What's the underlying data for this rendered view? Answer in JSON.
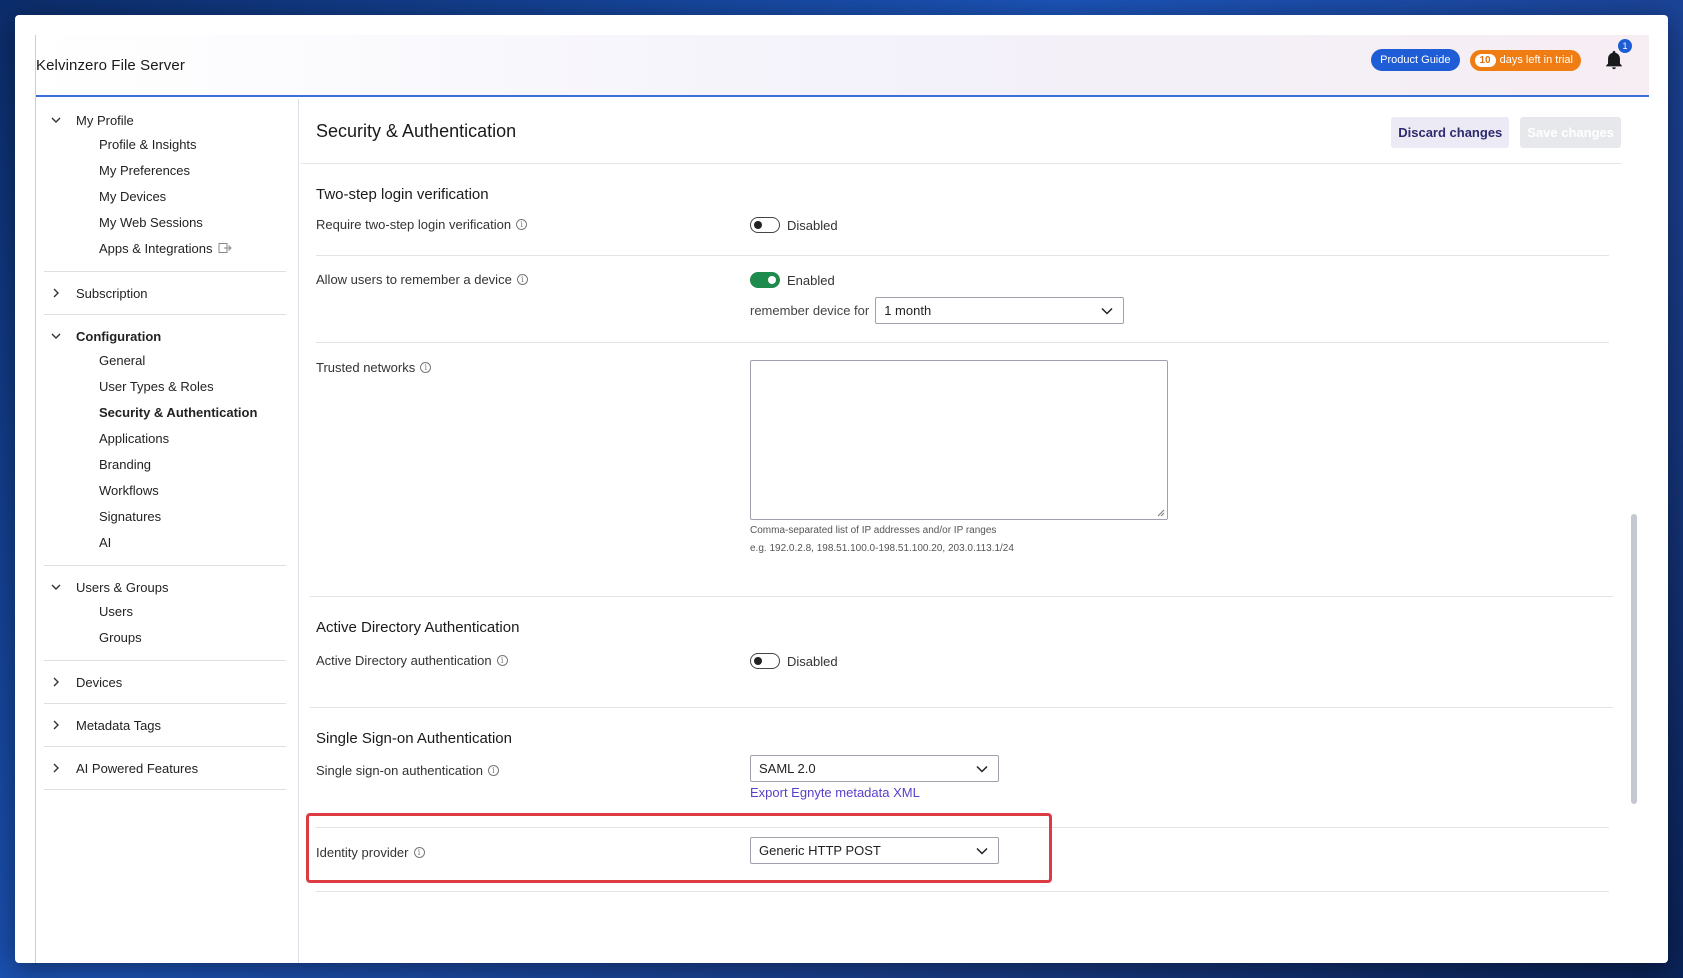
{
  "app": {
    "title": "Kelvinzero File Server",
    "product_guide": "Product Guide",
    "trial_days": "10",
    "trial_text": "days left in trial",
    "notification_count": "1"
  },
  "sidebar": {
    "groups": [
      {
        "label": "My Profile",
        "expanded": true,
        "items": [
          "Profile & Insights",
          "My Preferences",
          "My Devices",
          "My Web Sessions",
          "Apps & Integrations"
        ]
      },
      {
        "label": "Subscription",
        "expanded": false,
        "items": []
      },
      {
        "label": "Configuration",
        "expanded": true,
        "items": [
          "General",
          "User Types & Roles",
          "Security & Authentication",
          "Applications",
          "Branding",
          "Workflows",
          "Signatures",
          "AI"
        ]
      },
      {
        "label": "Users & Groups",
        "expanded": true,
        "items": [
          "Users",
          "Groups"
        ]
      },
      {
        "label": "Devices",
        "expanded": false,
        "items": []
      },
      {
        "label": "Metadata Tags",
        "expanded": false,
        "items": []
      },
      {
        "label": "AI Powered Features",
        "expanded": false,
        "items": []
      }
    ]
  },
  "page": {
    "title": "Security & Authentication",
    "discard_label": "Discard changes",
    "save_label": "Save changes"
  },
  "two_step": {
    "title": "Two-step login verification",
    "require_label": "Require two-step login verification",
    "require_state": "Disabled",
    "remember_label": "Allow users to remember a device",
    "remember_state": "Enabled",
    "remember_for_label": "remember device for",
    "remember_for_value": "1 month",
    "trusted_label": "Trusted networks",
    "trusted_hint": "Comma-separated list of IP addresses and/or IP ranges",
    "trusted_example": "e.g. 192.0.2.8, 198.51.100.0-198.51.100.20, 203.0.113.1/24"
  },
  "active_directory": {
    "title": "Active Directory Authentication",
    "label": "Active Directory authentication",
    "state": "Disabled"
  },
  "sso": {
    "title": "Single Sign-on Authentication",
    "label": "Single sign-on authentication",
    "value": "SAML 2.0",
    "export_link": "Export Egnyte metadata XML",
    "idp_label": "Identity provider",
    "idp_value": "Generic HTTP POST"
  },
  "colors": {
    "accent": "#1f5dd6",
    "trial": "#f07d14",
    "toggle_on": "#1e8a4c",
    "highlight": "#dc3b43",
    "link": "#5b3ec8"
  }
}
